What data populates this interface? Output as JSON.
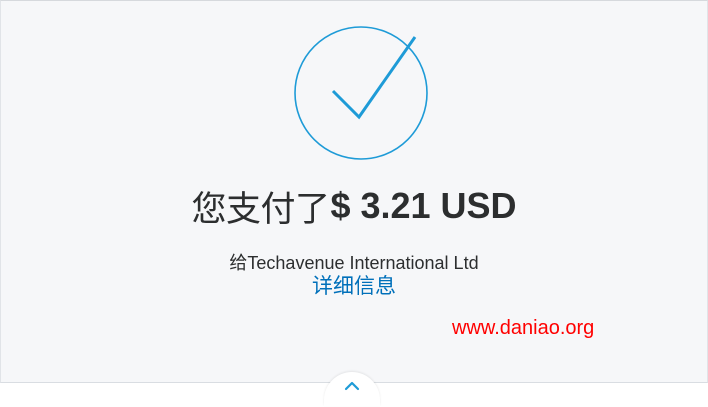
{
  "confirmation": {
    "amount_prefix": "您支付了",
    "amount_value": "$ 3.21 USD",
    "recipient_prefix": "给",
    "recipient_name": "Techavenue International Ltd",
    "details_link_label": "详细信息"
  },
  "watermark": {
    "text": "www.daniao.org"
  },
  "icons": {
    "success": "checkmark-circle-icon",
    "toggle": "chevron-up-icon"
  },
  "colors": {
    "accent": "#0070ba",
    "icon_blue": "#1e9bd7",
    "watermark": "#ff0000",
    "panel_bg": "#f6f7f9"
  }
}
